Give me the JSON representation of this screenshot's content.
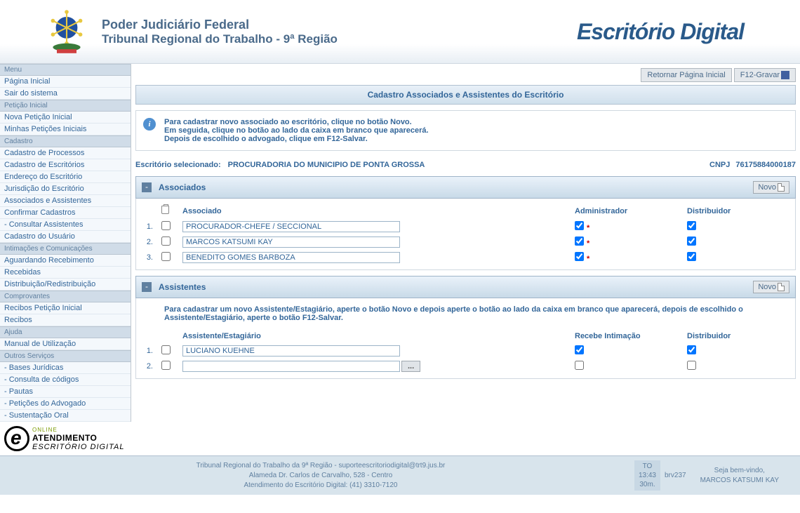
{
  "header": {
    "title1": "Poder Judiciário Federal",
    "title2": "Tribunal Regional do Trabalho - 9ª Região",
    "brand": "Escritório Digital"
  },
  "menu": {
    "groups": [
      {
        "label": "Menu",
        "items": [
          "Página Inicial",
          "Sair do sistema"
        ]
      },
      {
        "label": "Petição Inicial",
        "items": [
          "Nova Petição Inicial",
          "Minhas Petições Iniciais"
        ]
      },
      {
        "label": "Cadastro",
        "items": [
          "Cadastro de Processos",
          "Cadastro de Escritórios",
          "Endereço do Escritório",
          "Jurisdição do Escritório",
          "Associados e Assistentes",
          "Confirmar Cadastros",
          "- Consultar Assistentes",
          "Cadastro do Usuário"
        ]
      },
      {
        "label": "Intimações e Comunicações",
        "items": [
          "Aguardando Recebimento",
          "Recebidas",
          "Distribuição/Redistribuição"
        ]
      },
      {
        "label": "Comprovantes",
        "items": [
          "Recibos Petição Inicial",
          "Recibos"
        ]
      },
      {
        "label": "Ajuda",
        "items": [
          "Manual de Utilização"
        ]
      },
      {
        "label": "Outros Serviços",
        "items": [
          "- Bases Jurídicas",
          "- Consulta de códigos",
          "- Pautas",
          "- Petições do Advogado",
          "- Sustentação Oral"
        ]
      }
    ]
  },
  "top_buttons": {
    "retornar": "Retornar Página Inicial",
    "gravar": "F12-Gravar"
  },
  "page_title": "Cadastro Associados e Assistentes do Escritório",
  "info": {
    "line1": "Para cadastrar novo associado ao escritório, clique no botão Novo.",
    "line2": "Em seguida, clique no botão ao lado da caixa em branco que aparecerá.",
    "line3": "Depois de escolhido o advogado, clique em F12-Salvar."
  },
  "escritorio": {
    "label": "Escritório selecionado:",
    "name": "PROCURADORIA DO MUNICIPIO DE PONTA GROSSA",
    "cnpj_label": "CNPJ",
    "cnpj": "76175884000187"
  },
  "associados": {
    "title": "Associados",
    "novo": "Novo",
    "headers": {
      "associado": "Associado",
      "admin": "Administrador",
      "distr": "Distribuidor"
    },
    "rows": [
      {
        "n": "1.",
        "name": "PROCURADOR-CHEFE / SECCIONAL",
        "admin": true,
        "req": true,
        "distr": true
      },
      {
        "n": "2.",
        "name": "MARCOS KATSUMI KAY",
        "admin": true,
        "req": true,
        "distr": true
      },
      {
        "n": "3.",
        "name": "BENEDITO GOMES BARBOZA",
        "admin": true,
        "req": true,
        "distr": true
      }
    ]
  },
  "assistentes": {
    "title": "Assistentes",
    "novo": "Novo",
    "info": "Para cadastrar um novo Assistente/Estagiário, aperte o botão Novo e depois aperte o botão ao lado da caixa em branco que aparecerá, depois de escolhido o Assistente/Estagiário, aperte o botão F12-Salvar.",
    "headers": {
      "assist": "Assistente/Estagiário",
      "recebe": "Recebe Intimação",
      "distr": "Distribuidor"
    },
    "rows": [
      {
        "n": "1.",
        "name": "LUCIANO KUEHNE",
        "recebe": true,
        "distr": true,
        "lookup": false
      },
      {
        "n": "2.",
        "name": "",
        "recebe": false,
        "distr": false,
        "lookup": true
      }
    ],
    "lookup_label": "..."
  },
  "atendimento": {
    "line1": "ONLINE",
    "line2": "ATENDIMENTO",
    "line3": "ESCRITÓRIO DIGITAL"
  },
  "footer": {
    "info1": "Tribunal Regional do Trabalho da 9ª Região - suporteescritoriodigital@trt9.jus.br",
    "info2": "Alameda Dr. Carlos de Carvalho, 528 - Centro",
    "info3": "Atendimento do Escritório Digital: (41) 3310-7120",
    "to": "TO",
    "time": "13:43",
    "dur": "30m.",
    "srv": "brv237",
    "welcome1": "Seja bem-vindo,",
    "welcome2": "MARCOS KATSUMI KAY"
  }
}
